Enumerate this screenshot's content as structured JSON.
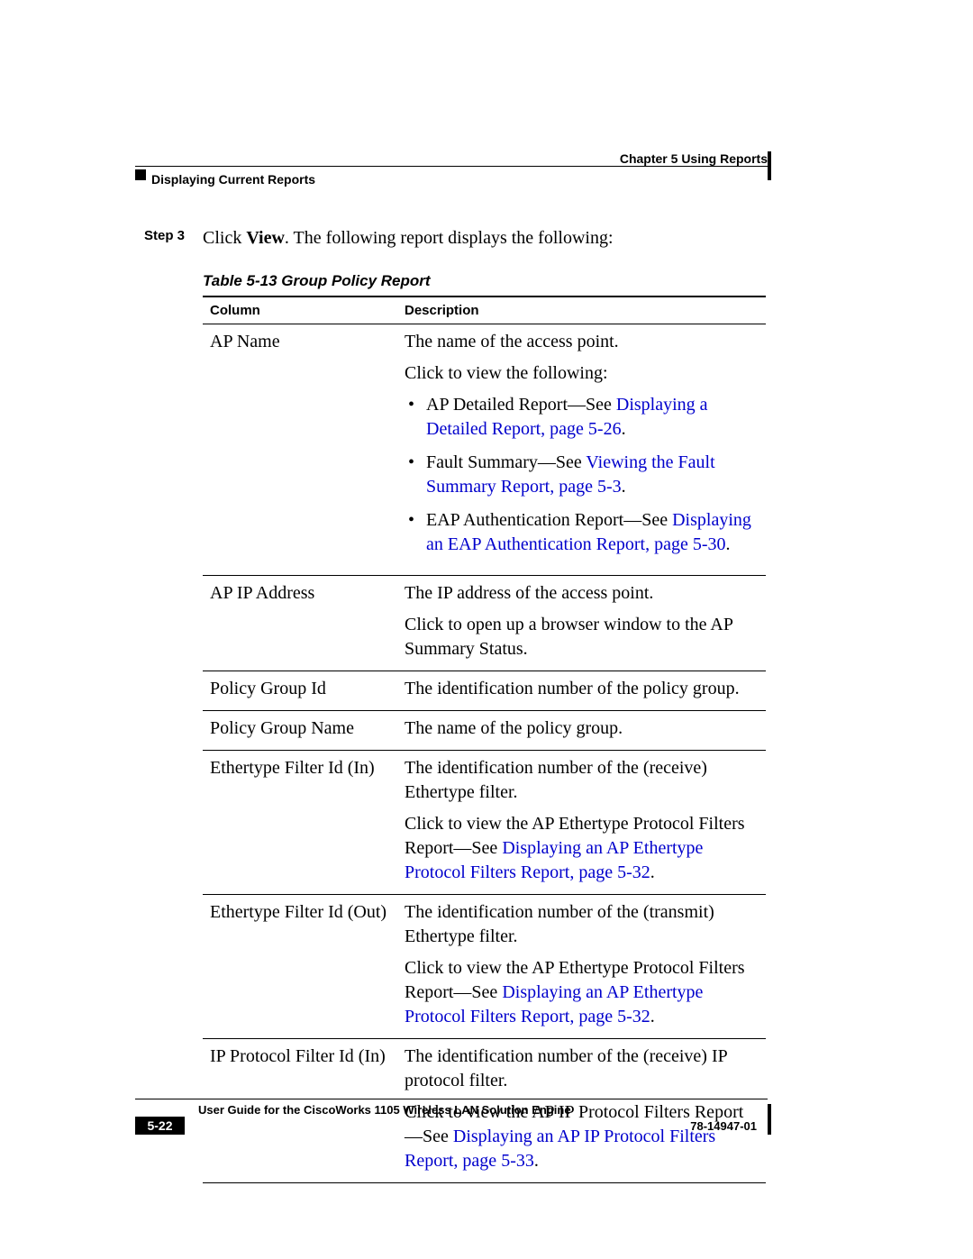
{
  "header": {
    "chapter": "Chapter 5      Using Reports",
    "section": "Displaying Current Reports"
  },
  "step": {
    "label": "Step 3",
    "pre": "Click ",
    "bold": "View",
    "post": ". The following report displays the following:"
  },
  "caption": "Table 5-13    Group Policy Report",
  "th": {
    "c1": "Column",
    "c2": "Description"
  },
  "rows": {
    "r0": {
      "col": "AP Name",
      "p0": "The name of the access point.",
      "p1": "Click to view the following:",
      "b0a": "AP Detailed Report—See ",
      "b0l": "Displaying a Detailed Report, page 5-26",
      "b1a": "Fault Summary—See ",
      "b1l": "Viewing the Fault Summary Report, page 5-3",
      "b2a": "EAP Authentication Report—See ",
      "b2l": "Displaying an EAP Authentication Report, page 5-30"
    },
    "r1": {
      "col": "AP IP Address",
      "p0": "The IP address of the access point.",
      "p1": "Click to open up a browser window to the AP Summary Status."
    },
    "r2": {
      "col": "Policy Group Id",
      "p0": "The identification number of the policy group."
    },
    "r3": {
      "col": "Policy Group Name",
      "p0": "The name of the policy group."
    },
    "r4": {
      "col": "Ethertype Filter Id (In)",
      "p0": "The identification number of the (receive) Ethertype filter.",
      "p1a": "Click to view the AP Ethertype Protocol Filters Report—See ",
      "p1l": "Displaying an AP Ethertype Protocol Filters Report, page 5-32"
    },
    "r5": {
      "col": "Ethertype Filter Id (Out)",
      "p0": "The identification number of the (transmit) Ethertype filter.",
      "p1a": "Click to view the AP Ethertype Protocol Filters Report—See ",
      "p1l": "Displaying an AP Ethertype Protocol Filters Report, page 5-32"
    },
    "r6": {
      "col": "IP Protocol Filter Id (In)",
      "p0": "The identification number of the (receive) IP protocol filter.",
      "p1a": "Click to view the AP IP Protocol Filters Report—See ",
      "p1l": "Displaying an AP IP Protocol Filters Report, page 5-33"
    }
  },
  "footer": {
    "title": "User Guide for the CiscoWorks 1105 Wireless LAN Solution Engine",
    "page": "5-22",
    "doc": "78-14947-01"
  }
}
